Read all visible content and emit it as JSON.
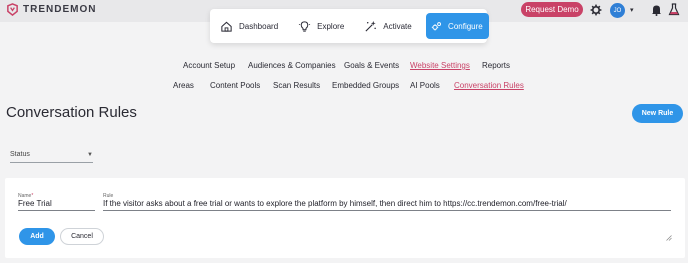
{
  "brand": {
    "name": "TRENDEMON"
  },
  "topnav": [
    {
      "label": "Dashboard",
      "icon": "house-icon"
    },
    {
      "label": "Explore",
      "icon": "lightbulb-icon"
    },
    {
      "label": "Activate",
      "icon": "sparkle-wand-icon"
    },
    {
      "label": "Configure",
      "icon": "gears-icon",
      "active": true
    }
  ],
  "header": {
    "request_demo": "Request Demo",
    "avatar_initials": "JO"
  },
  "subtabs_row1": [
    "Account Setup",
    "Audiences & Companies",
    "Goals & Events",
    "Website Settings",
    "Reports"
  ],
  "subtabs_row2": [
    "Areas",
    "Content Pools",
    "Scan Results",
    "Embedded Groups",
    "AI Pools",
    "Conversation Rules"
  ],
  "active_subtabs": [
    "Website Settings",
    "Conversation Rules"
  ],
  "page": {
    "title": "Conversation Rules",
    "new_rule": "New Rule",
    "status_label": "Status"
  },
  "form": {
    "name_label": "Name",
    "name_required": "*",
    "name_value": "Free Trial",
    "rule_label": "Rule",
    "rule_value": "If the visitor asks about a free trial or wants to explore the platform by himself, then direct him to https://cc.trendemon.com/free-trial/",
    "add": "Add",
    "cancel": "Cancel"
  },
  "colors": {
    "accent": "#2f95e8",
    "brand": "#c94267",
    "background": "#f3f3f4"
  }
}
